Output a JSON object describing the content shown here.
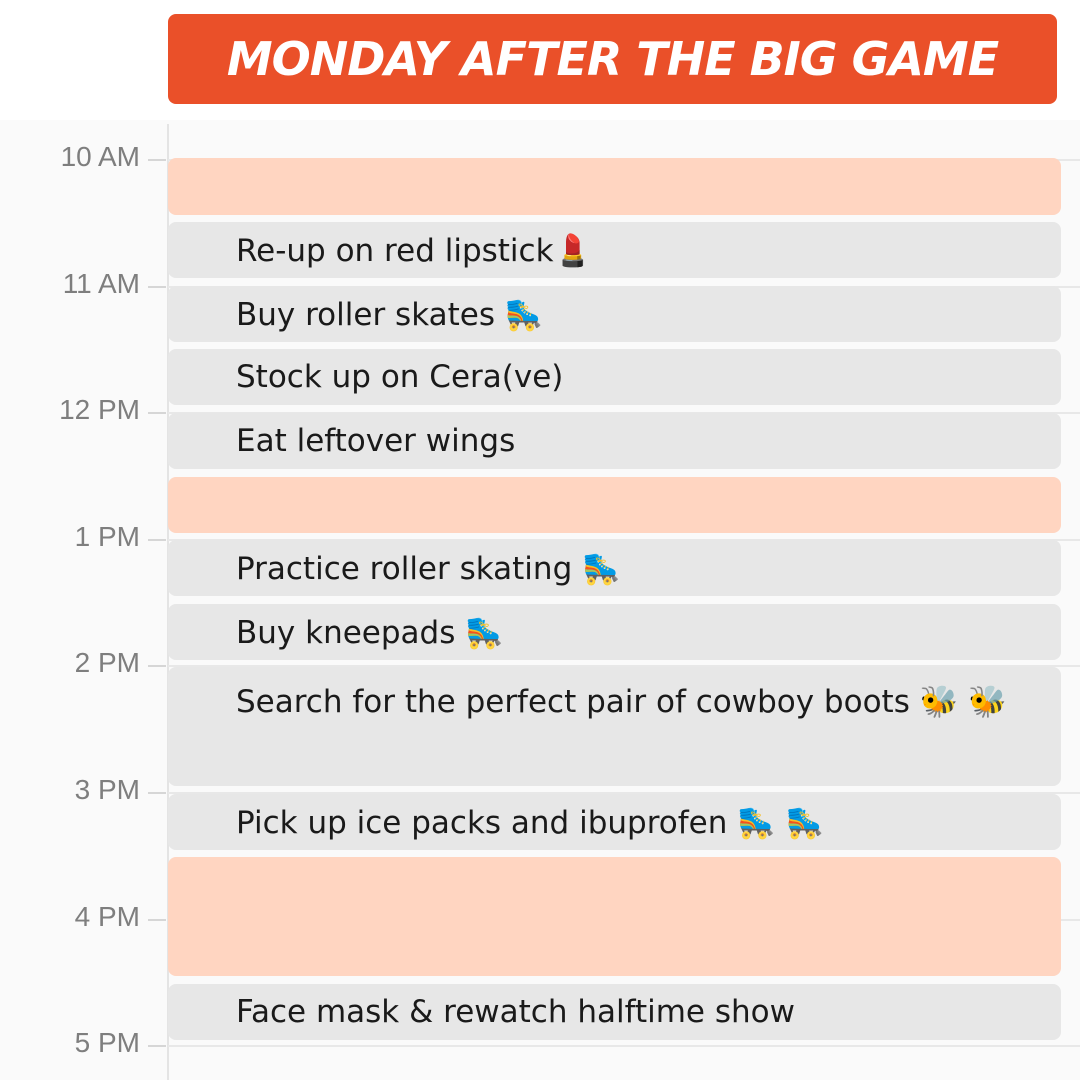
{
  "title": "MONDAY AFTER THE BIG GAME",
  "colors": {
    "title_bg": "#ea5029",
    "event_gray": "#e7e7e7",
    "event_peach": "#ffd5c1",
    "label_gray": "#7e7e7e"
  },
  "hours": [
    {
      "label": "10 AM"
    },
    {
      "label": "11 AM"
    },
    {
      "label": "12 PM"
    },
    {
      "label": "1 PM"
    },
    {
      "label": "2 PM"
    },
    {
      "label": "3 PM"
    },
    {
      "label": "4 PM"
    },
    {
      "label": "5 PM"
    }
  ],
  "events": [
    {
      "text": ""
    },
    {
      "text": "Re-up on red lipstick💄"
    },
    {
      "text": "Buy roller skates 🛼"
    },
    {
      "text": "Stock up on Cera(ve)"
    },
    {
      "text": "Eat leftover wings"
    },
    {
      "text": ""
    },
    {
      "text": "Practice roller skating 🛼"
    },
    {
      "text": "Buy kneepads 🛼"
    },
    {
      "text": "Search for the perfect pair of cowboy boots 🐝 🐝"
    },
    {
      "text": "Pick up ice packs and ibuprofen 🛼 🛼"
    },
    {
      "text": ""
    },
    {
      "text": "Face mask & rewatch halftime show"
    }
  ]
}
